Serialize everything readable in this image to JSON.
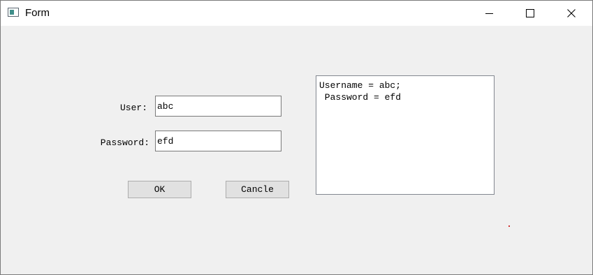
{
  "window": {
    "title": "Form",
    "controls": [
      "minimize-icon",
      "maximize-icon",
      "close-icon"
    ]
  },
  "form": {
    "user_label": "User:",
    "user_value": "abc",
    "password_label": "Password:",
    "password_value": "efd",
    "ok_label": "OK",
    "cancel_label": "Cancle"
  },
  "output": {
    "line1": "Username = abc;",
    "line2": " Password = efd"
  },
  "colors": {
    "window_bg": "#f0f0f0",
    "titlebar_bg": "#ffffff",
    "button_bg": "#e1e1e1",
    "dot": "#d03030"
  }
}
